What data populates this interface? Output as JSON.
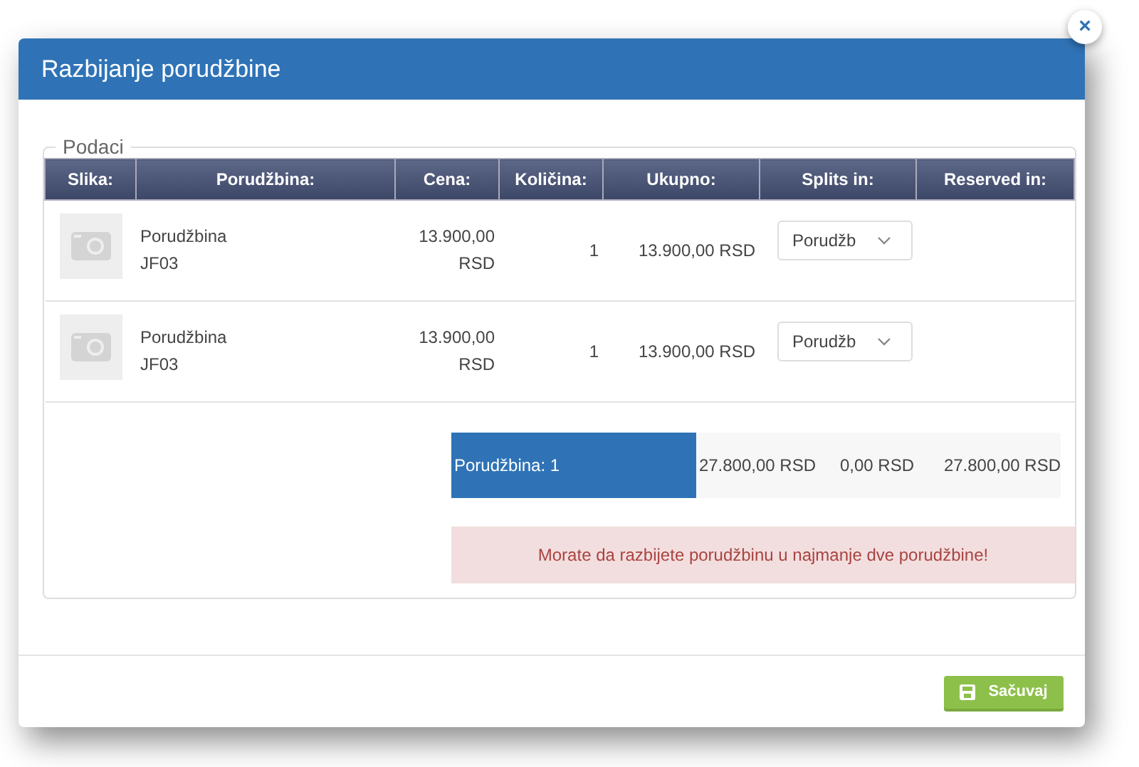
{
  "dialog": {
    "title": "Razbijanje porudžbine",
    "close": "×"
  },
  "fieldset": {
    "legend": "Podaci"
  },
  "table": {
    "columns": [
      "Slika:",
      "Porudžbina:",
      "Cena:",
      "Količina:",
      "Ukupno:",
      "Splits in:",
      "Reserved in:"
    ],
    "rows": [
      {
        "order": "Porudžbina\nJF03",
        "price": "13.900,00 RSD",
        "quantity": "1",
        "total": "13.900,00 RSD",
        "splits_in": "Porudžb"
      },
      {
        "order": "Porudžbina\nJF03",
        "price": "13.900,00 RSD",
        "quantity": "1",
        "total": "13.900,00 RSD",
        "splits_in": "Porudžb"
      }
    ]
  },
  "summary": {
    "label": "Porudžbina: 1",
    "cells": [
      "27.800,00 RSD",
      "0,00 RSD",
      "27.800,00 RSD"
    ]
  },
  "alert": {
    "message": "Morate da razbijete porudžbinu u najmanje dve porudžbine!"
  },
  "buttons": [
    {
      "label": "Sačuvaj"
    }
  ]
}
